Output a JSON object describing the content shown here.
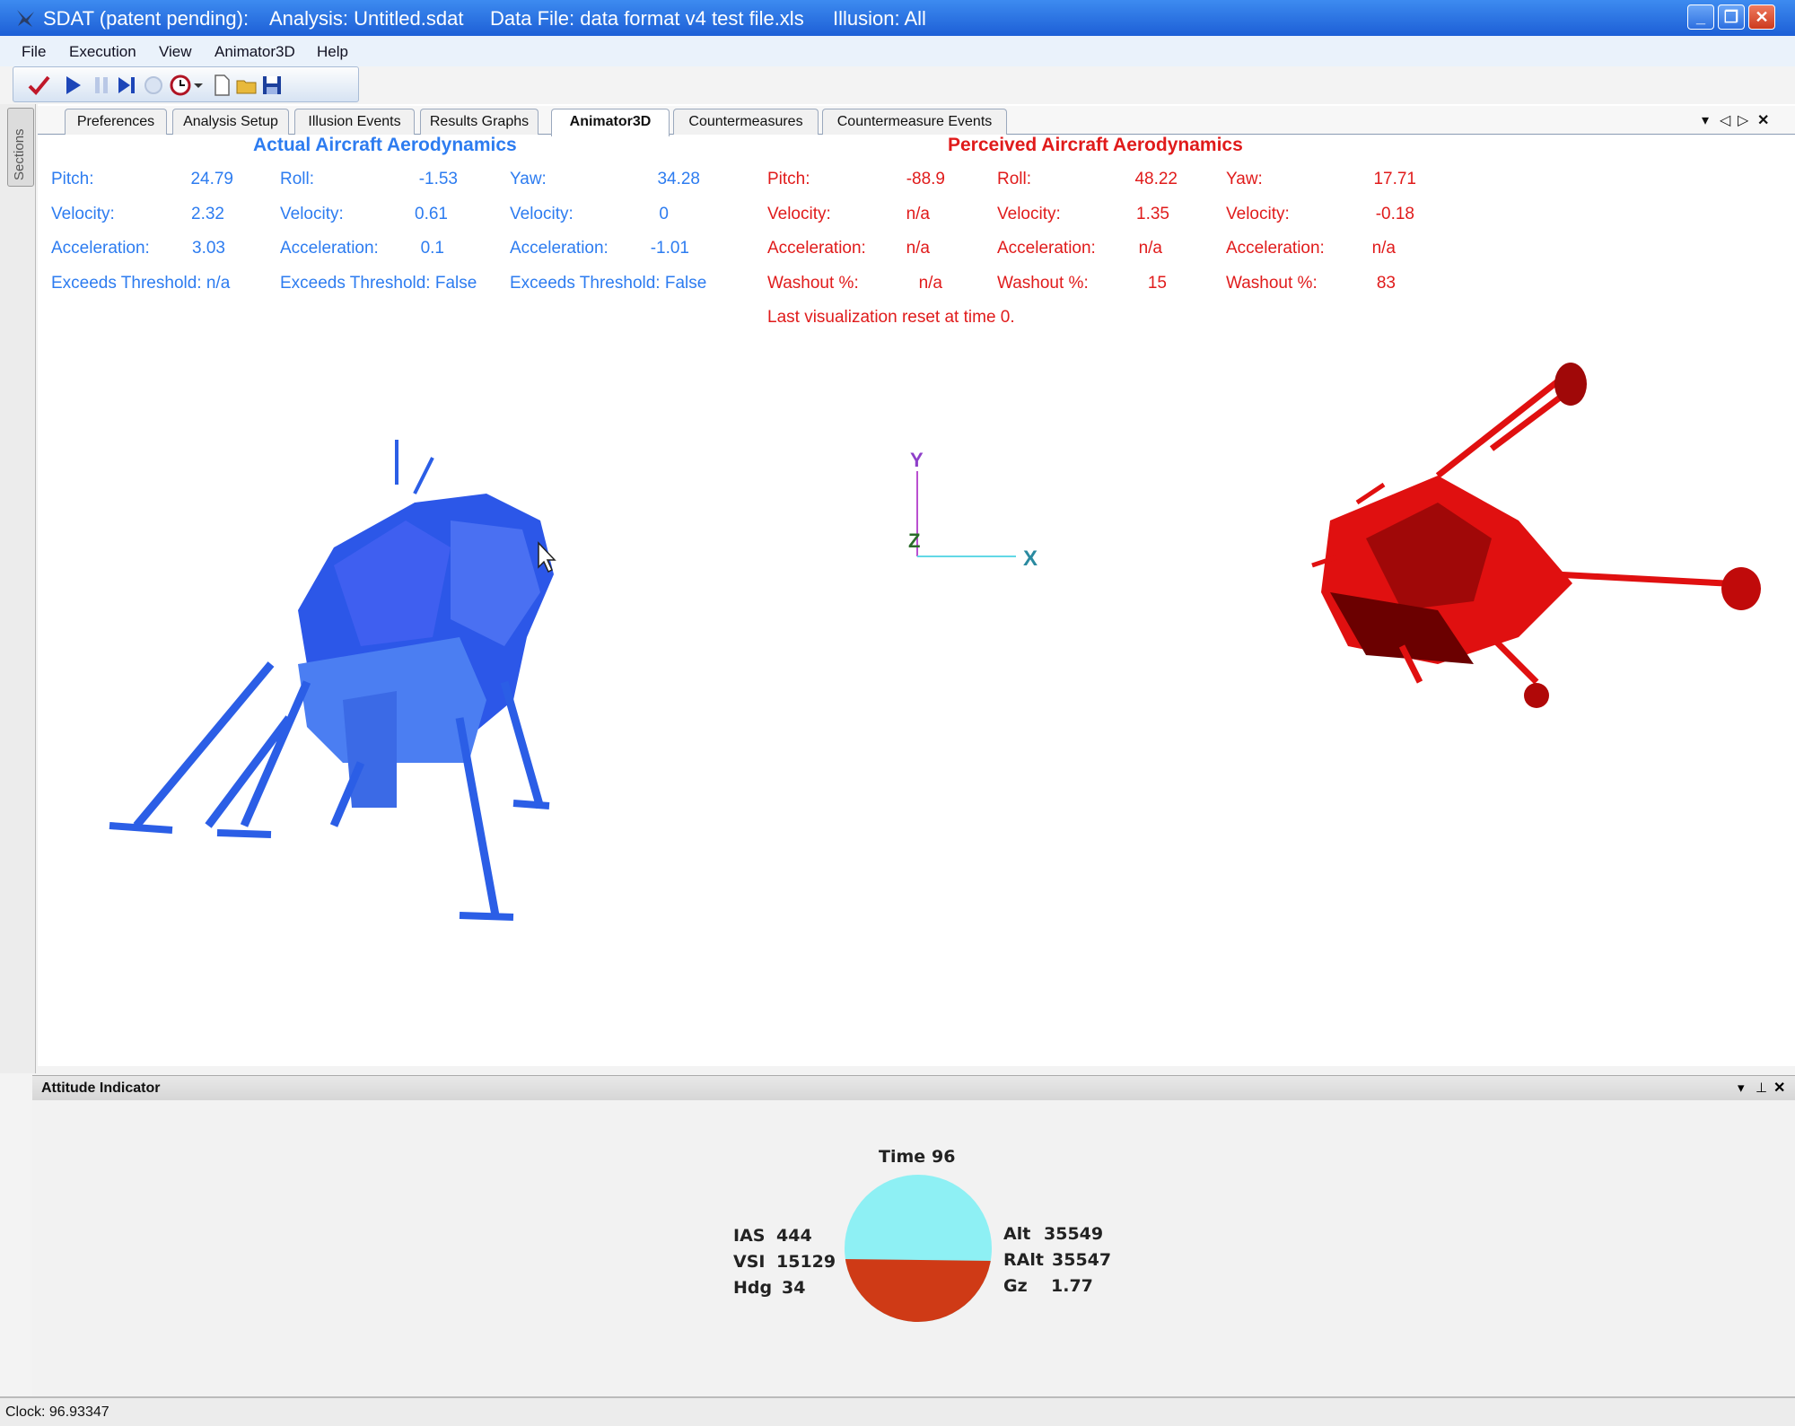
{
  "window": {
    "app": "SDAT (patent pending):",
    "analysis": "Analysis: Untitled.sdat",
    "datafile": "Data File: data format v4 test file.xls",
    "illusion": "Illusion: All"
  },
  "menu": [
    "File",
    "Execution",
    "View",
    "Animator3D",
    "Help"
  ],
  "toolbar_icons": [
    "check-icon",
    "play-icon",
    "pause-icon",
    "step-icon",
    "stop-icon",
    "timer-icon",
    "dropdown-icon",
    "new-file-icon",
    "open-folder-icon",
    "save-icon"
  ],
  "sidebar": {
    "sections_label": "Sections"
  },
  "tabs": [
    "Preferences",
    "Analysis Setup",
    "Illusion Events",
    "Results Graphs",
    "Animator3D",
    "Countermeasures",
    "Countermeasure Events"
  ],
  "active_tab": "Animator3D",
  "actual": {
    "title": "Actual Aircraft Aerodynamics",
    "color": "#2d7cf0",
    "pitch": {
      "label": "Pitch:",
      "value": "24.79",
      "velocity_label": "Velocity:",
      "velocity": "2.32",
      "accel_label": "Acceleration:",
      "accel": "3.03",
      "threshold": "Exceeds Threshold: n/a"
    },
    "roll": {
      "label": "Roll:",
      "value": "-1.53",
      "velocity_label": "Velocity:",
      "velocity": "0.61",
      "accel_label": "Acceleration:",
      "accel": "0.1",
      "threshold": "Exceeds Threshold: False"
    },
    "yaw": {
      "label": "Yaw:",
      "value": "34.28",
      "velocity_label": "Velocity:",
      "velocity": "0",
      "accel_label": "Acceleration:",
      "accel": "-1.01",
      "threshold": "Exceeds Threshold: False"
    }
  },
  "perceived": {
    "title": "Perceived Aircraft Aerodynamics",
    "color": "#e01b1b",
    "pitch": {
      "label": "Pitch:",
      "value": "-88.9",
      "velocity_label": "Velocity:",
      "velocity": "n/a",
      "accel_label": "Acceleration:",
      "accel": "n/a",
      "washout_label": "Washout %:",
      "washout": "n/a"
    },
    "roll": {
      "label": "Roll:",
      "value": "48.22",
      "velocity_label": "Velocity:",
      "velocity": "1.35",
      "accel_label": "Acceleration:",
      "accel": "n/a",
      "washout_label": "Washout %:",
      "washout": "15"
    },
    "yaw": {
      "label": "Yaw:",
      "value": "17.71",
      "velocity_label": "Velocity:",
      "velocity": "-0.18",
      "accel_label": "Acceleration:",
      "accel": "n/a",
      "washout_label": "Washout %:",
      "washout": "83"
    },
    "reset_note": "Last visualization reset at time 0."
  },
  "axes": {
    "y": "Y",
    "z": "Z",
    "x": "X"
  },
  "attitude": {
    "panel_title": "Attitude Indicator",
    "time_label": "Time",
    "time": "96",
    "ias_label": "IAS",
    "ias": "444",
    "vsi_label": "VSI",
    "vsi": "15129",
    "hdg_label": "Hdg",
    "hdg": "34",
    "alt_label": "Alt",
    "alt": "35549",
    "ralt_label": "RAlt",
    "ralt": "35547",
    "gz_label": "Gz",
    "gz": "1.77",
    "sky_color": "#8ef0f4",
    "ground_color": "#cf3a16"
  },
  "status": {
    "clock": "Clock: 96.93347"
  }
}
